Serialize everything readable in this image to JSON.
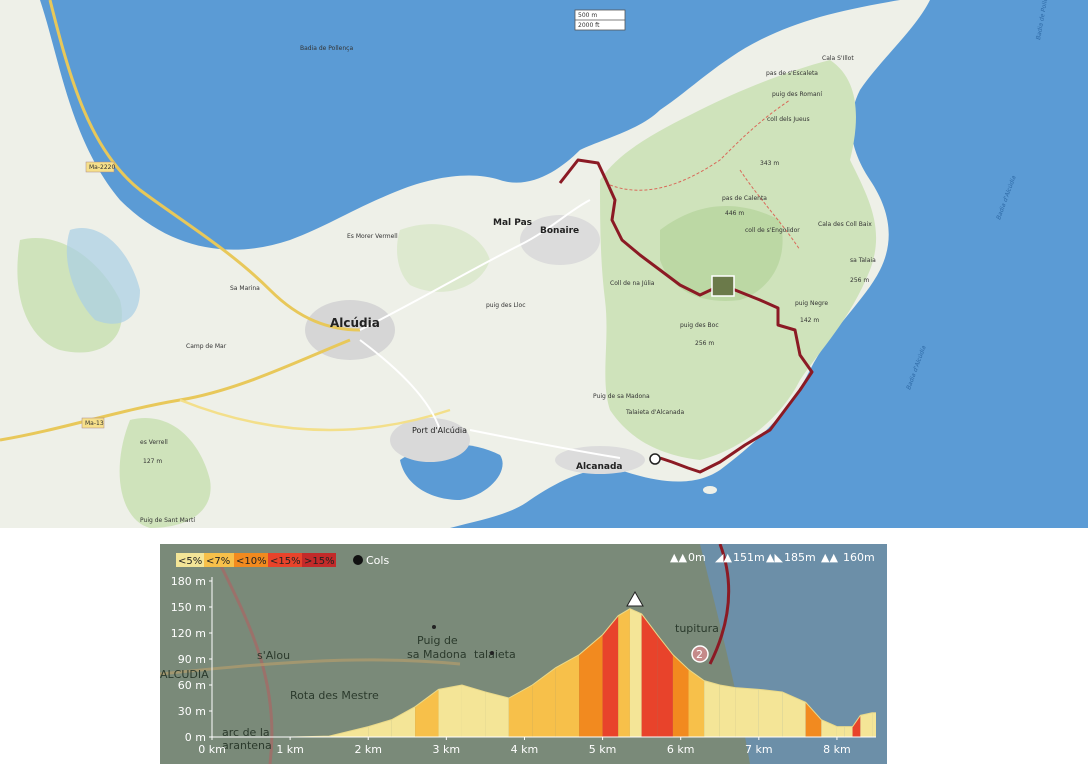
{
  "map": {
    "scale": {
      "top": "500 m",
      "bottom": "2000 ft"
    },
    "places": {
      "alcudia": "Alcúdia",
      "bonaire": "Bonaire",
      "mal_pas": "Mal Pas",
      "port_alcudia": "Port d'Alcúdia",
      "alcanada": "Alcanada",
      "es_mores_vermell": "Es Morer Vermell",
      "badia": "Badia de Pollença",
      "sa_marina": "Sa Marina",
      "puig_de_sa_madona": "Puig de sa Madona",
      "talaieta": "Talaieta d'Alcanada",
      "coll_de_sa_creu": "Coll de na Júlia",
      "puig_des_boc": "puig des Boc",
      "es_verrell": "es Verrell",
      "puig_de_sant_marti": "Puig de Sant Martí",
      "la_talaia": "sa Talaia",
      "puig_negre": "puig Negre",
      "coll_baix": "Cala des Coll Baix",
      "penya": "pas de s'Escaleta",
      "puig_des_romani": "puig des Romaní",
      "coll_des_jueus": "coll dels Jueus",
      "puig_de_sa_cabra": "pas de Calenta",
      "coll_de_sa_bataia": "coll de s'Engolidor",
      "cala_sant_pere": "Cala S'Illot",
      "puig_des_lloc": "puig des Lloc",
      "camp": "Camp de Mar"
    },
    "elevations": {
      "e1": "256 m",
      "e2": "446 m",
      "e3": "256 m",
      "e4": "142 m",
      "e5": "343 m",
      "e6": "127 m"
    },
    "roads": {
      "ma2220": "Ma-2220",
      "ma13": "Ma-13"
    },
    "sea_labels": {
      "s1": "Badia d'Alcúdia",
      "s2": "Badia d'Alcúdia",
      "s3": "Badia de Pollença"
    },
    "colors": {
      "sea": "#5b9bd5",
      "land": "#eef0e8",
      "forest": "#cfe3bb",
      "route": "#8b1a24"
    },
    "route_icons": {
      "start": "start-flag-icon",
      "photo": "photo-thumbnail-icon"
    }
  },
  "profile": {
    "legend": [
      "<5%",
      "<7%",
      "<10%",
      "<15%",
      ">15%"
    ],
    "legend_colors": [
      "#f4e597",
      "#f7c04a",
      "#f28a1f",
      "#e8432b",
      "#c22a2a"
    ],
    "cols_label": "Cols",
    "stats": {
      "min": "0m",
      "ascent": "151m",
      "max": "185m",
      "descent": "160m"
    },
    "y_ticks": [
      "0 m",
      "30 m",
      "60 m",
      "90 m",
      "120 m",
      "150 m",
      "180 m"
    ],
    "x_ticks": [
      "0 km",
      "1 km",
      "2 km",
      "3 km",
      "4 km",
      "5 km",
      "6 km",
      "7 km",
      "8 km"
    ],
    "background_labels": {
      "s_alou": "s'Alou",
      "puig_a": "Puig de",
      "puig_b": "sa Madona",
      "talaieta": "talaieta",
      "rota": "Rota des Mestre",
      "alcudia": "ALCUDIA",
      "arc": "arc de la",
      "arc2": "arantena",
      "tupitura": "tupitura",
      "marker": "2"
    }
  },
  "chart_data": {
    "type": "area",
    "title": "",
    "xlabel": "",
    "ylabel": "",
    "xlim": [
      0,
      8.5
    ],
    "ylim": [
      0,
      180
    ],
    "x": [
      0,
      0.5,
      1.0,
      1.5,
      2.0,
      2.3,
      2.6,
      2.9,
      3.2,
      3.5,
      3.8,
      4.1,
      4.4,
      4.7,
      5.0,
      5.2,
      5.35,
      5.5,
      5.7,
      5.9,
      6.1,
      6.3,
      6.5,
      6.7,
      7.0,
      7.3,
      7.6,
      7.8,
      8.0,
      8.1,
      8.2,
      8.3,
      8.45,
      8.5
    ],
    "series": [
      {
        "values": [
          0,
          0,
          0,
          1,
          12,
          20,
          35,
          55,
          60,
          52,
          45,
          60,
          80,
          95,
          118,
          140,
          148,
          142,
          118,
          95,
          78,
          65,
          60,
          57,
          55,
          52,
          40,
          20,
          12,
          12,
          12,
          25,
          28,
          28
        ]
      }
    ]
  }
}
